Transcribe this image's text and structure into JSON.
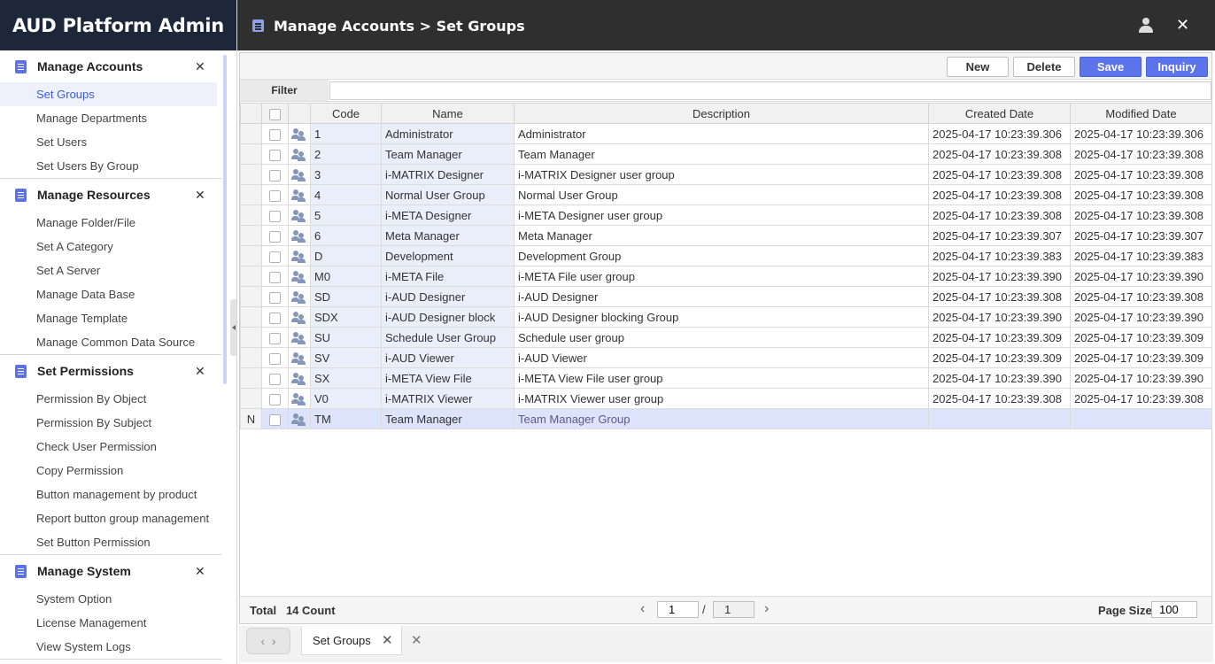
{
  "app": {
    "title": "AUD Platform Admin"
  },
  "header": {
    "breadcrumb": "Manage Accounts > Set Groups"
  },
  "sidebar": {
    "groups": [
      {
        "title": "Manage Accounts",
        "items": [
          "Set Groups",
          "Manage Departments",
          "Set Users",
          "Set Users By Group"
        ]
      },
      {
        "title": "Manage Resources",
        "items": [
          "Manage Folder/File",
          "Set A Category",
          "Set A Server",
          "Manage Data Base",
          "Manage Template",
          "Manage Common Data Source"
        ]
      },
      {
        "title": "Set Permissions",
        "items": [
          "Permission By Object",
          "Permission By Subject",
          "Check User Permission",
          "Copy Permission",
          "Button management by product",
          "Report button group management",
          "Set Button Permission"
        ]
      },
      {
        "title": "Manage System",
        "items": [
          "System Option",
          "License Management",
          "View System Logs"
        ]
      }
    ],
    "active_item": "Set Groups"
  },
  "toolbar": {
    "new_label": "New",
    "delete_label": "Delete",
    "save_label": "Save",
    "inquiry_label": "Inquiry"
  },
  "filter": {
    "label": "Filter",
    "value": ""
  },
  "table": {
    "columns": [
      "Code",
      "Name",
      "Description",
      "Created Date",
      "Modified Date"
    ],
    "rows": [
      {
        "status": "",
        "code": "1",
        "name": "Administrator",
        "description": "Administrator",
        "created": "2025-04-17 10:23:39.306",
        "modified": "2025-04-17 10:23:39.306"
      },
      {
        "status": "",
        "code": "2",
        "name": "Team Manager",
        "description": "Team Manager",
        "created": "2025-04-17 10:23:39.308",
        "modified": "2025-04-17 10:23:39.308"
      },
      {
        "status": "",
        "code": "3",
        "name": "i-MATRIX Designer",
        "description": "i-MATRIX Designer user group",
        "created": "2025-04-17 10:23:39.308",
        "modified": "2025-04-17 10:23:39.308"
      },
      {
        "status": "",
        "code": "4",
        "name": "Normal User Group",
        "description": "Normal User Group",
        "created": "2025-04-17 10:23:39.308",
        "modified": "2025-04-17 10:23:39.308"
      },
      {
        "status": "",
        "code": "5",
        "name": "i-META Designer",
        "description": "i-META Designer user group",
        "created": "2025-04-17 10:23:39.308",
        "modified": "2025-04-17 10:23:39.308"
      },
      {
        "status": "",
        "code": "6",
        "name": "Meta Manager",
        "description": "Meta Manager",
        "created": "2025-04-17 10:23:39.307",
        "modified": "2025-04-17 10:23:39.307"
      },
      {
        "status": "",
        "code": "D",
        "name": "Development",
        "description": "Development Group",
        "created": "2025-04-17 10:23:39.383",
        "modified": "2025-04-17 10:23:39.383"
      },
      {
        "status": "",
        "code": "M0",
        "name": "i-META File",
        "description": "i-META File user group",
        "created": "2025-04-17 10:23:39.390",
        "modified": "2025-04-17 10:23:39.390"
      },
      {
        "status": "",
        "code": "SD",
        "name": "i-AUD Designer",
        "description": "i-AUD Designer",
        "created": "2025-04-17 10:23:39.308",
        "modified": "2025-04-17 10:23:39.308"
      },
      {
        "status": "",
        "code": "SDX",
        "name": "i-AUD Designer block",
        "description": "i-AUD Designer blocking Group",
        "created": "2025-04-17 10:23:39.390",
        "modified": "2025-04-17 10:23:39.390"
      },
      {
        "status": "",
        "code": "SU",
        "name": "Schedule User Group",
        "description": "Schedule user group",
        "created": "2025-04-17 10:23:39.309",
        "modified": "2025-04-17 10:23:39.309"
      },
      {
        "status": "",
        "code": "SV",
        "name": "i-AUD Viewer",
        "description": "i-AUD Viewer",
        "created": "2025-04-17 10:23:39.309",
        "modified": "2025-04-17 10:23:39.309"
      },
      {
        "status": "",
        "code": "SX",
        "name": "i-META View File",
        "description": "i-META View File user group",
        "created": "2025-04-17 10:23:39.390",
        "modified": "2025-04-17 10:23:39.390"
      },
      {
        "status": "",
        "code": "V0",
        "name": "i-MATRIX Viewer",
        "description": "i-MATRIX Viewer user group",
        "created": "2025-04-17 10:23:39.308",
        "modified": "2025-04-17 10:23:39.308"
      },
      {
        "status": "N",
        "code": "TM",
        "name": "Team Manager",
        "description": "Team Manager Group",
        "created": "",
        "modified": ""
      }
    ]
  },
  "footer": {
    "total_label": "Total",
    "count_text": "14 Count",
    "current_page": "1",
    "separator": "/",
    "total_pages": "1",
    "page_size_label": "Page Size",
    "page_size": "100"
  },
  "tabs": {
    "items": [
      {
        "label": "Set Groups"
      }
    ]
  },
  "icons": {
    "close": "✕",
    "prev": "‹",
    "next": "›",
    "tab_close": "✕"
  }
}
